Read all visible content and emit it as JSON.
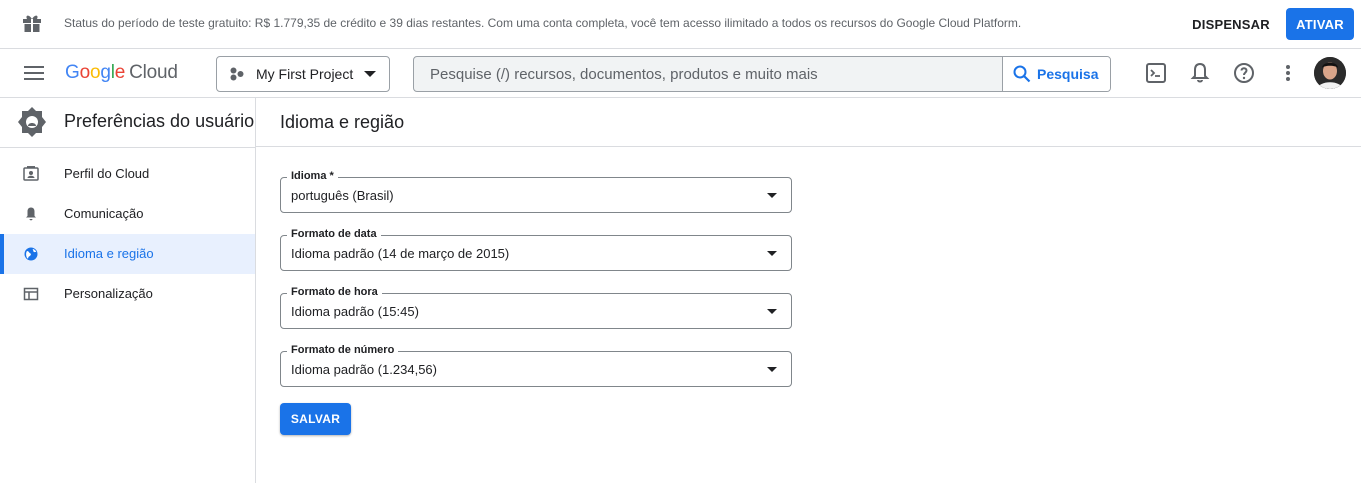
{
  "banner": {
    "message": "Status do período de teste gratuito: R$ 1.779,35 de crédito e 39 dias restantes. Com uma conta completa, você tem acesso ilimitado a todos os recursos do Google Cloud Platform.",
    "dismiss_label": "DISPENSAR",
    "activate_label": "ATIVAR",
    "gift_icon": "gift-icon"
  },
  "topbar": {
    "logo_google": [
      "G",
      "o",
      "o",
      "g",
      "l",
      "e"
    ],
    "logo_product": "Cloud",
    "project_name": "My First Project",
    "search_placeholder": "Pesquise (/) recursos, documentos, produtos e muito mais",
    "search_button": "Pesquisa",
    "icons": [
      "menu-icon",
      "terminal-icon",
      "bell-icon",
      "help-icon",
      "more-vert-icon"
    ]
  },
  "sidebar": {
    "title": "Preferências do usuário",
    "items": [
      {
        "label": "Perfil do Cloud",
        "icon": "profile-card-icon"
      },
      {
        "label": "Comunicação",
        "icon": "bell-icon"
      },
      {
        "label": "Idioma e região",
        "icon": "globe-icon",
        "active": true
      },
      {
        "label": "Personalização",
        "icon": "layout-icon"
      }
    ]
  },
  "main": {
    "title": "Idioma e região",
    "fields": [
      {
        "label": "Idioma *",
        "value": "português (Brasil)"
      },
      {
        "label": "Formato de data",
        "value": "Idioma padrão (14 de março de 2015)"
      },
      {
        "label": "Formato de hora",
        "value": "Idioma padrão (15:45)"
      },
      {
        "label": "Formato de número",
        "value": "Idioma padrão (1.234,56)"
      }
    ],
    "save_label": "SALVAR"
  },
  "colors": {
    "accent": "#1a73e8",
    "active_bg": "#e8f0fe",
    "border": "#dadce0"
  }
}
